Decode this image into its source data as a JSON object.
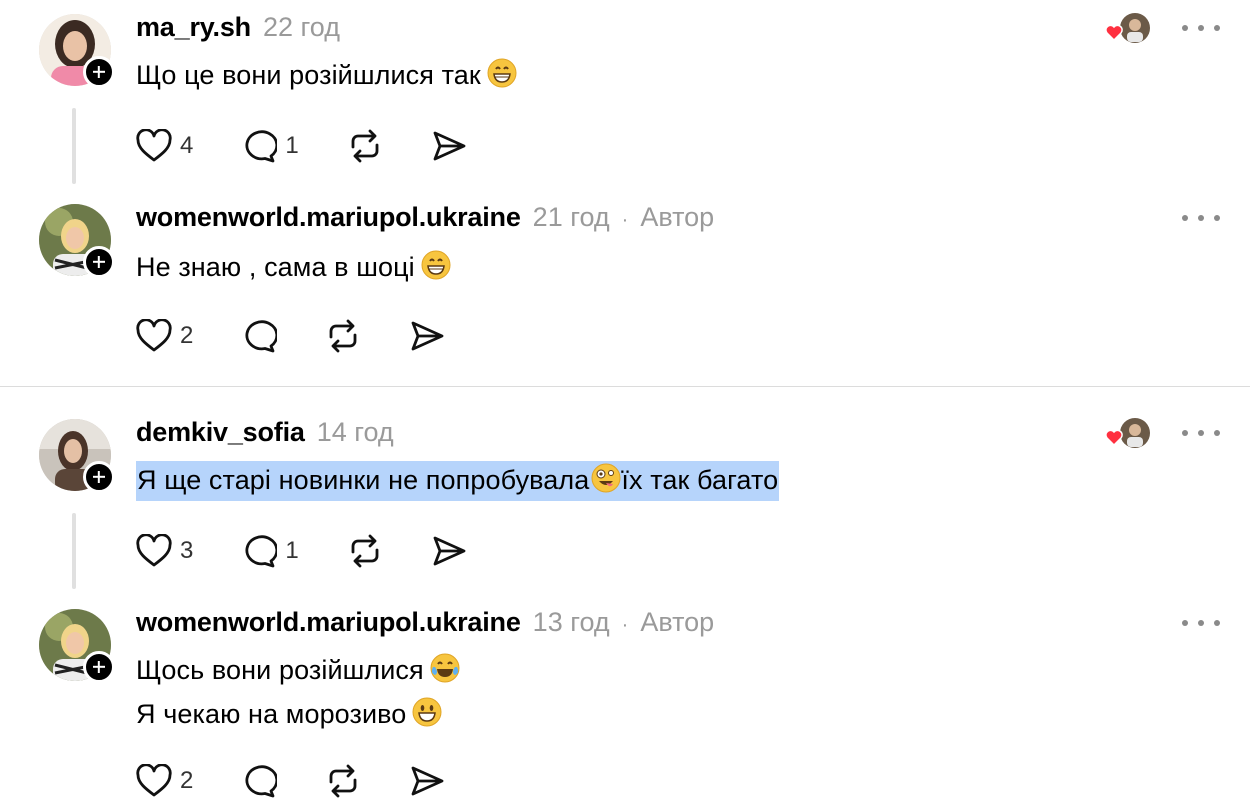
{
  "comments": [
    {
      "username": "ma_ry.sh",
      "time": "22 год",
      "author": "",
      "lines": [
        "Що це вони розійшлися так"
      ],
      "likes": "4",
      "replies": "1"
    },
    {
      "username": "womenworld.mariupol.ukraine",
      "time": "21 год",
      "author": "Автор",
      "lines": [
        "Не знаю , сама в шоці"
      ],
      "likes": "2",
      "replies": ""
    },
    {
      "username": "demkiv_sofia",
      "time": "14 год",
      "author": "",
      "lines": [
        "Я ще старі новинки не попробувала",
        "їх так багато"
      ],
      "likes": "3",
      "replies": "1"
    },
    {
      "username": "womenworld.mariupol.ukraine",
      "time": "13 год",
      "author": "Автор",
      "lines": [
        "Щось вони розійшлися",
        "Я чекаю на морозиво"
      ],
      "likes": "2",
      "replies": ""
    }
  ],
  "icons": {
    "like": "heart-icon",
    "reply": "comment-bubble-icon",
    "repost": "repost-icon",
    "share": "send-icon",
    "more": "more-dots-icon",
    "follow": "plus-icon",
    "liked_by_author": "red-heart-icon"
  },
  "colors": {
    "text": "#000000",
    "muted": "#9a9a9a",
    "highlight": "#b6d4fb",
    "heart": "#ff3040",
    "divider": "#dcdcdc"
  }
}
